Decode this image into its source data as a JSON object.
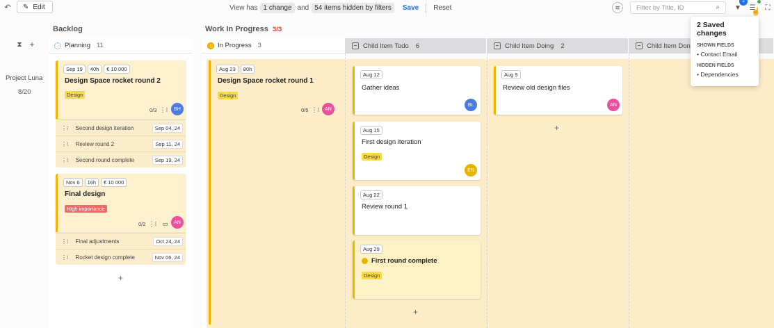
{
  "toolbar": {
    "edit_label": "Edit",
    "view_prefix": "View has",
    "change_pill": "1 change",
    "and_text": "and",
    "hidden_pill": "54 items hidden by filters",
    "save_label": "Save",
    "reset_label": "Reset",
    "filter_placeholder": "Filter by Title, ID",
    "filter_badge": "1"
  },
  "swimlane": {
    "name": "Project Luna",
    "progress": "8/20"
  },
  "sections": {
    "backlog": "Backlog",
    "wip": "Work In Progress",
    "wip_limit": "3/3"
  },
  "columns": {
    "planning": {
      "label": "Planning",
      "count": "11"
    },
    "in_progress": {
      "label": "In Progress",
      "count": "3"
    },
    "child_todo": {
      "label": "Child Item Todo",
      "count": "6"
    },
    "child_doing": {
      "label": "Child Item Doing",
      "count": "2"
    },
    "child_done": {
      "label": "Child Item Done"
    }
  },
  "planning_cards": [
    {
      "date": "Sep 19",
      "hours": "40h",
      "cost": "€ 10 000",
      "title": "Design Space rocket round 2",
      "label": "Design",
      "children": "0/3",
      "avatar": "BH",
      "subitems": [
        {
          "title": "Second design iteration",
          "date": "Sep 04, 24"
        },
        {
          "title": "Review round 2",
          "date": "Sep 11, 24"
        },
        {
          "title": "Second round complete",
          "date": "Sep 19, 24"
        }
      ]
    },
    {
      "date": "Nov 6",
      "hours": "16h",
      "cost": "€ 10 000",
      "title": "Final design",
      "label": "High importance",
      "children": "0/2",
      "avatar": "AN",
      "subitems": [
        {
          "title": "Final adjustments",
          "date": "Oct 24, 24"
        },
        {
          "title": "Rocket design complete",
          "date": "Nov 06, 24"
        }
      ]
    }
  ],
  "in_progress_card": {
    "date": "Aug 23",
    "hours": "80h",
    "title": "Design Space rocket round 1",
    "label": "Design",
    "children": "0/5",
    "avatar": "AN"
  },
  "todo_cards": [
    {
      "date": "Aug 12",
      "title": "Gather ideas",
      "avatar": "BL"
    },
    {
      "date": "Aug 15",
      "title": "First design iteration",
      "label": "Design",
      "avatar": "EN"
    },
    {
      "date": "Aug 22",
      "title": "Review round 1"
    },
    {
      "date": "Aug 29",
      "title": "First round complete",
      "label": "Design"
    }
  ],
  "doing_cards": [
    {
      "date": "Aug 9",
      "title": "Review old design files",
      "avatar": "AN"
    }
  ],
  "popup": {
    "title": "2 Saved changes",
    "shown_header": "SHOWN FIELDS",
    "shown_items": [
      "Contact Email"
    ],
    "hidden_header": "HIDDEN FIELDS",
    "hidden_items": [
      "Dependencies"
    ]
  },
  "add_symbol": "+",
  "colors": {
    "accent": "#1a73e8",
    "lane": "#fdecc8",
    "wip_limit": "#e53935",
    "design_label": "#f8d94a",
    "high_label": "#f06a6a"
  }
}
